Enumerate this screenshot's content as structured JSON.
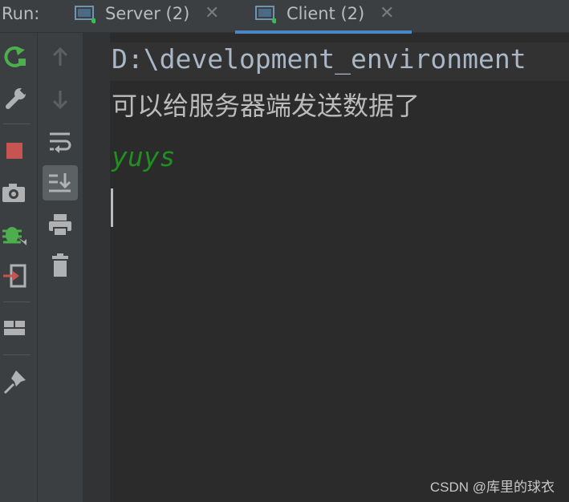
{
  "run_panel": {
    "label": "Run:",
    "tabs": [
      {
        "title": "Server (2)",
        "icon": "console-icon",
        "status_dot_color": "#3cba54",
        "active": false
      },
      {
        "title": "Client (2)",
        "icon": "console-icon",
        "status_dot_color": "#3cba54",
        "active": true
      }
    ]
  },
  "toolbar_left": [
    {
      "icon": "rerun-icon",
      "color": "#4cae4c"
    },
    {
      "icon": "wrench-icon",
      "color": "#afb1b3"
    },
    {
      "icon": "stop-icon",
      "color": "#c75450"
    },
    {
      "icon": "camera-icon",
      "color": "#afb1b3"
    },
    {
      "icon": "debug-bug-icon",
      "color": "#4cae4c"
    },
    {
      "icon": "exit-icon",
      "color": "#c75450"
    },
    {
      "icon": "layout-icon",
      "color": "#afb1b3"
    },
    {
      "icon": "pin-icon",
      "color": "#afb1b3"
    }
  ],
  "toolbar_second": [
    {
      "icon": "arrow-up-icon",
      "enabled": false
    },
    {
      "icon": "arrow-down-icon",
      "enabled": false
    },
    {
      "icon": "soft-wrap-icon",
      "enabled": true
    },
    {
      "icon": "scroll-to-end-icon",
      "enabled": true,
      "selected": true
    },
    {
      "icon": "print-icon",
      "enabled": true
    },
    {
      "icon": "trash-icon",
      "enabled": true
    }
  ],
  "console": {
    "command_line": "D:\\development_environment",
    "output_line": "可以给服务器端发送数据了",
    "user_input": "yuys"
  },
  "watermark": "CSDN @库里的球衣"
}
